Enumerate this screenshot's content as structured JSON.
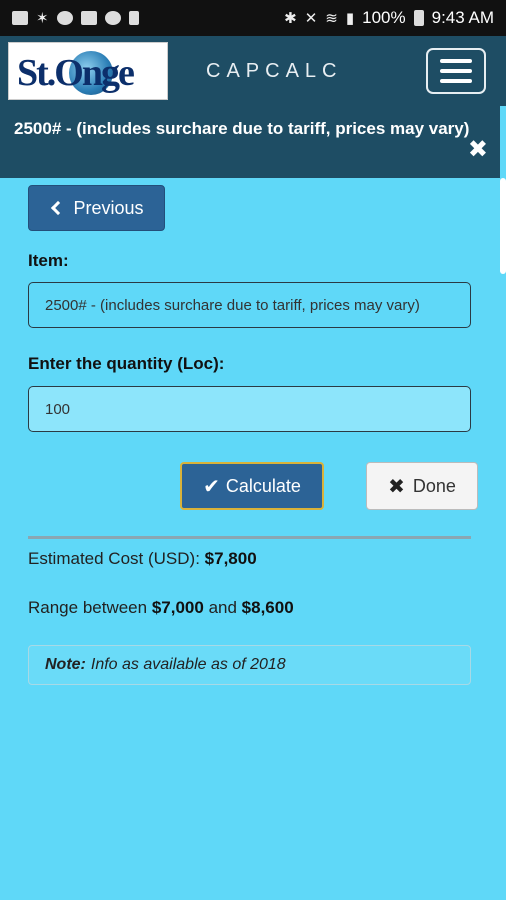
{
  "status_bar": {
    "battery": "100%",
    "time": "9:43 AM"
  },
  "header": {
    "logo_text": "St.Onge",
    "app_title": "CAPCALC"
  },
  "alert": {
    "message": "2500# - (includes surchare due to tariff, prices may vary)"
  },
  "form": {
    "previous_label": "Previous",
    "item_label": "Item:",
    "item_value": "2500# - (includes surchare due to tariff, prices may vary)",
    "quantity_label": "Enter the quantity (Loc):",
    "quantity_value": "100",
    "calculate_label": "Calculate",
    "done_label": "Done"
  },
  "results": {
    "estimated_label": "Estimated Cost (USD):",
    "estimated_value": "$7,800",
    "range_prefix": "Range between",
    "range_low": "$7,000",
    "range_mid": "and",
    "range_high": "$8,600"
  },
  "note": {
    "label": "Note:",
    "text": "Info as available as of 2018"
  }
}
